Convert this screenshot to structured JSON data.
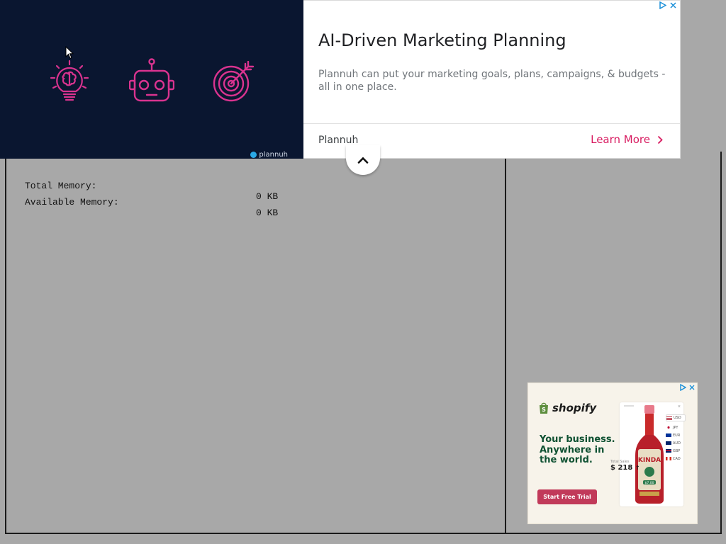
{
  "memory": {
    "total_label": "Total Memory:",
    "total_value": "0 KB",
    "available_label": "Available Memory:",
    "available_value": "0 KB"
  },
  "top_ad": {
    "headline": "AI-Driven Marketing Planning",
    "body": "Plannuh can put your marketing goals, plans, campaigns, & budgets - all in one place.",
    "advertiser": "Plannuh",
    "cta": "Learn More",
    "watermark": "plannuh",
    "colors": {
      "visual_bg": "#0a1630",
      "icon": "#d9338f",
      "cta": "#d81b60"
    },
    "icons": [
      "lightbulb-brain-icon",
      "robot-icon",
      "target-icon"
    ]
  },
  "shopify_ad": {
    "brand": "shopify",
    "tagline": "Your business. Anywhere in the world.",
    "button": "Start Free Trial",
    "price_label": "Total Sales",
    "price": "$ 218",
    "product_label": "KINDA",
    "product_price": "$7.00",
    "currency_selected": "USD",
    "currencies": [
      "JPY",
      "EUR",
      "AUD",
      "GBP",
      "CAD"
    ]
  }
}
